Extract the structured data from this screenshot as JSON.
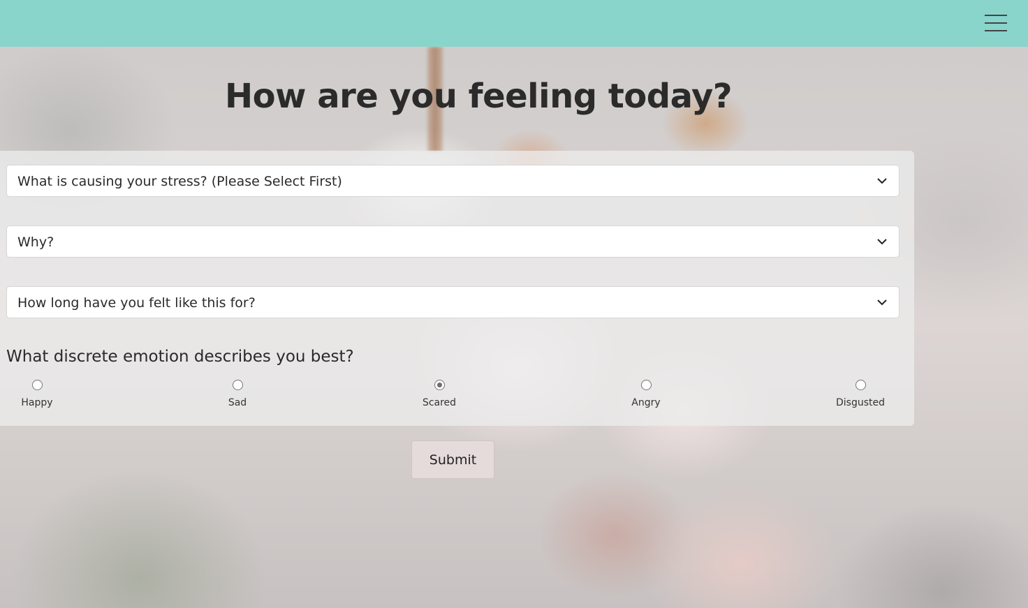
{
  "page": {
    "title": "How are you feeling today?"
  },
  "header": {
    "menu_icon": "hamburger-menu-icon",
    "background_color": "#89d4cb"
  },
  "form": {
    "selects": [
      {
        "value": "What is causing your stress? (Please Select First)",
        "icon": "chevron-down-icon"
      },
      {
        "value": "Why?",
        "icon": "chevron-down-icon"
      },
      {
        "value": "How long have you felt like this for?",
        "icon": "chevron-down-icon"
      }
    ],
    "emotion_question": "What discrete emotion describes you best?",
    "emotions": [
      {
        "label": "Happy",
        "checked": false
      },
      {
        "label": "Sad",
        "checked": false
      },
      {
        "label": "Scared",
        "checked": true
      },
      {
        "label": "Angry",
        "checked": false
      },
      {
        "label": "Disgusted",
        "checked": false
      }
    ],
    "submit_label": "Submit"
  }
}
